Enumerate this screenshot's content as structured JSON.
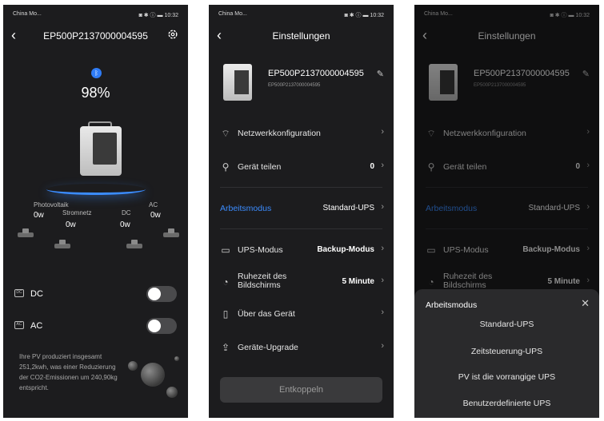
{
  "status": {
    "carrier": "China Mo...",
    "time": "10:32",
    "sys_icons": "◙ ✱ ⓘ ▬"
  },
  "screen1": {
    "back_icon": "chevron-left-icon",
    "title": "EP500P2137000004595",
    "gear_icon": "gear-icon",
    "battery": "98%",
    "flows": {
      "photovoltaik_label": "Photovoltaik",
      "photovoltaik_value": "0w",
      "stromnetz_label": "Stromnetz",
      "stromnetz_value": "0w",
      "dc_label": "DC",
      "dc_value": "0w",
      "ac_label": "AC",
      "ac_value": "0w"
    },
    "toggles": [
      {
        "label": "DC",
        "icon_text": "DC",
        "on": false
      },
      {
        "label": "AC",
        "icon_text": "AC",
        "on": false
      }
    ],
    "pv_text": "Ihre PV produziert insgesamt 251,2kwh, was einer Reduzierung der CO2-Emissionen um 240,90kg entspricht."
  },
  "screen2": {
    "title": "Einstellungen",
    "device_name": "EP500P2137000004595",
    "device_sub": "EP500P2137000004595",
    "rows": [
      {
        "label": "Netzwerkkonfiguration",
        "value": "",
        "icon": "wifi-icon"
      },
      {
        "label": "Gerät teilen",
        "value": "0",
        "icon": "share-user-icon"
      },
      {
        "label": "Arbeitsmodus",
        "value": "Standard-UPS",
        "icon": ""
      },
      {
        "label": "UPS-Modus",
        "value": "Backup-Modus",
        "icon": "ups-icon"
      },
      {
        "label": "Ruhezeit des Bildschirms",
        "value": "5 Minute",
        "icon": "timer-icon"
      },
      {
        "label": "Über das Gerät",
        "value": "",
        "icon": "document-icon"
      },
      {
        "label": "Geräte-Upgrade",
        "value": "",
        "icon": "upgrade-icon"
      }
    ],
    "disconnect": "Entkoppeln"
  },
  "sheet": {
    "title": "Arbeitsmodus",
    "options": [
      "Standard-UPS",
      "Zeitsteuerung-UPS",
      "PV ist die vorrangige UPS",
      "Benutzerdefinierte UPS"
    ]
  },
  "colors": {
    "accent": "#3b8cff",
    "background": "#1c1c1e"
  }
}
